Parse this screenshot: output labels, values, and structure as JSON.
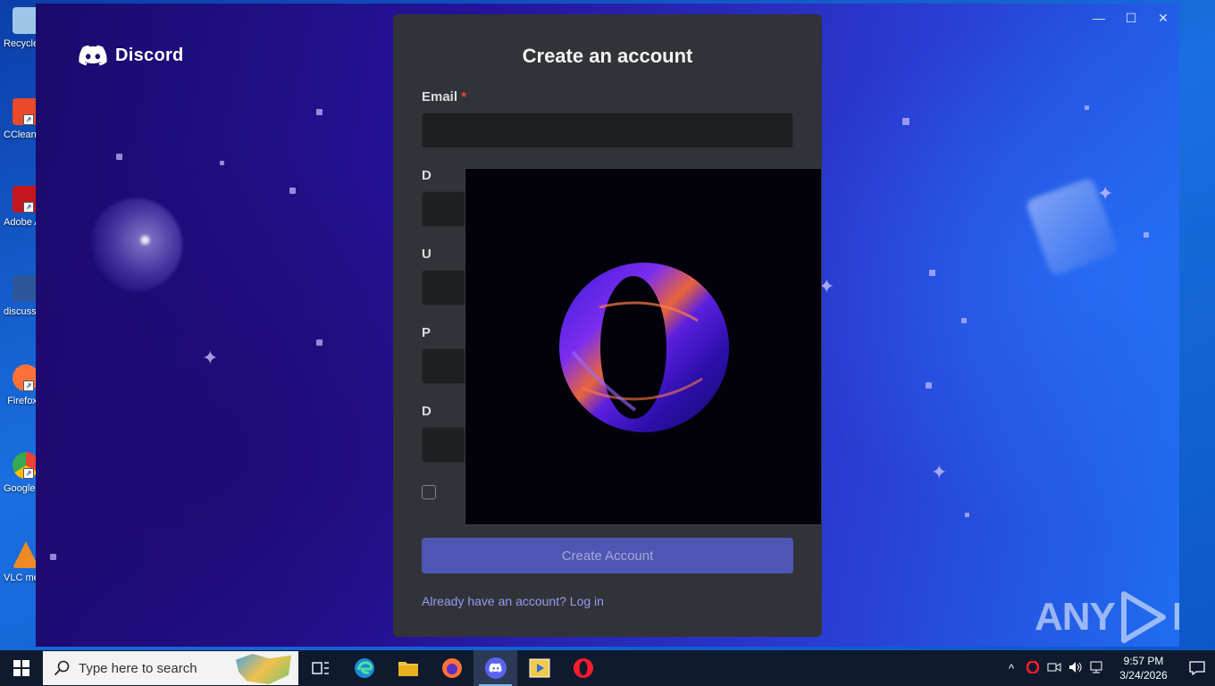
{
  "desktop": {
    "icons": [
      {
        "label": "Recycle Bin",
        "color": "#9fc5e8"
      },
      {
        "label": "CCleaner",
        "color": "#e84a2a"
      },
      {
        "label": "Adobe Acrobat",
        "color": "#c4161c"
      },
      {
        "label": "discuss...",
        "color": "#2b579a"
      },
      {
        "label": "Firefox",
        "color": "#ff7139"
      },
      {
        "label": "Google Chrome",
        "color": "#34a853"
      },
      {
        "label": "VLC media player",
        "color": "#f08a24"
      }
    ]
  },
  "window": {
    "controls": {
      "minimize": "—",
      "maximize": "☐",
      "close": "✕"
    },
    "brand": "Discord"
  },
  "form": {
    "title": "Create an account",
    "email_label": "Email",
    "required_mark": "*",
    "email_value": "",
    "hidden_labels": [
      "D",
      "U",
      "P",
      "D"
    ],
    "submit_label": "Create Account",
    "login_link": "Already have an account? Log in"
  },
  "overlay": {
    "logo": "opera-logo-icon"
  },
  "watermark": {
    "left": "ANY",
    "right": "RUN"
  },
  "taskbar": {
    "search_placeholder": "Type here to search",
    "apps": [
      "task-view",
      "edge",
      "file-explorer",
      "firefox",
      "discord",
      "media-player",
      "opera"
    ],
    "tray": {
      "chevron": "^",
      "time": "9:57 PM",
      "date": "3/24/2026"
    }
  },
  "colors": {
    "card_bg": "#313338",
    "input_bg": "#1e1f22",
    "button_bg": "#4e56b4",
    "link": "#949cf7",
    "required": "#f23f42"
  }
}
